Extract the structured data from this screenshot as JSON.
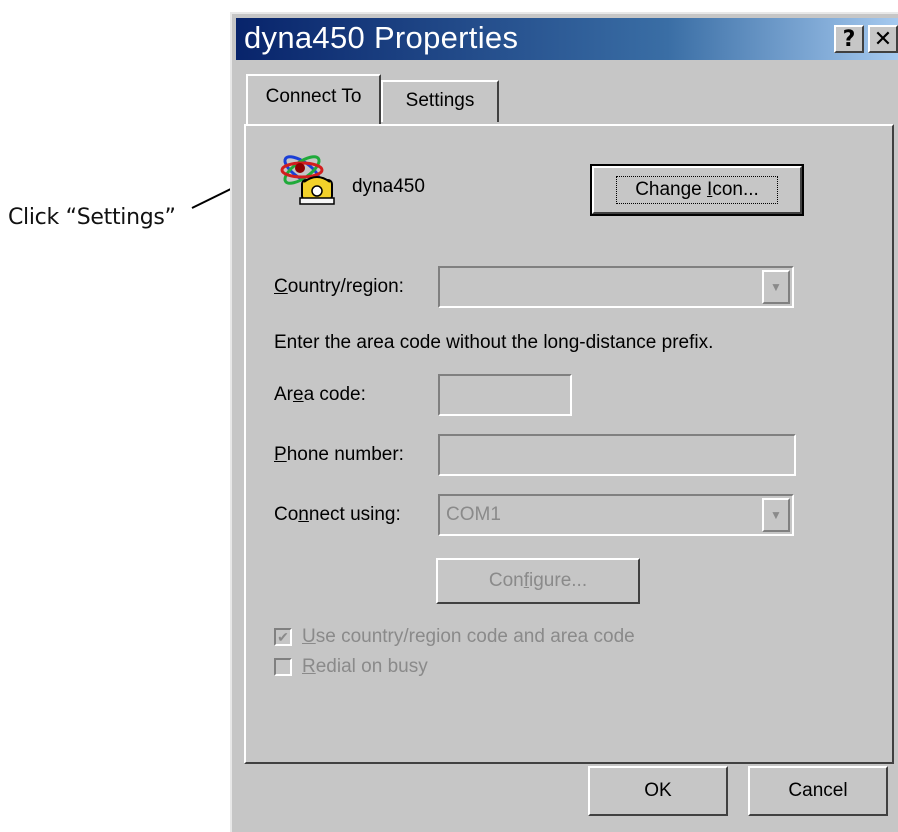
{
  "callout": {
    "text": "Click “Settings”"
  },
  "window": {
    "title": "dyna450 Properties",
    "help_button": "?",
    "close_button": "✕"
  },
  "tabs": [
    {
      "label": "Connect To",
      "active": true
    },
    {
      "label": "Settings",
      "active": false
    }
  ],
  "connection": {
    "name": "dyna450",
    "change_icon_button": {
      "pre": "Change ",
      "mnemonic": "I",
      "post": "con..."
    }
  },
  "form": {
    "country_label": {
      "mnemonic": "C",
      "rest": "ountry/region:"
    },
    "country_value": "",
    "info_text": "Enter the area code without the long-distance prefix.",
    "area_code_label": {
      "pre": "Ar",
      "mnemonic": "e",
      "post": "a code:"
    },
    "area_code_value": "",
    "phone_label": {
      "mnemonic": "P",
      "rest": "hone number:"
    },
    "phone_value": "",
    "connect_using_label": {
      "pre": "Co",
      "mnemonic": "n",
      "post": "nect using:"
    },
    "connect_using_value": "COM1",
    "configure_button": {
      "pre": "Con",
      "mnemonic": "f",
      "post": "igure..."
    }
  },
  "checkboxes": [
    {
      "mnemonic": "U",
      "rest": "se country/region code and area code",
      "checked": true,
      "enabled": false
    },
    {
      "mnemonic": "R",
      "rest": "edial on busy",
      "checked": false,
      "enabled": false
    }
  ],
  "footer": {
    "ok_label": "OK",
    "cancel_label": "Cancel"
  },
  "colors": {
    "face": "#c6c6c6",
    "title_start": "#08246b",
    "title_end": "#a6caf0",
    "disabled_text": "#8a8a8a"
  }
}
